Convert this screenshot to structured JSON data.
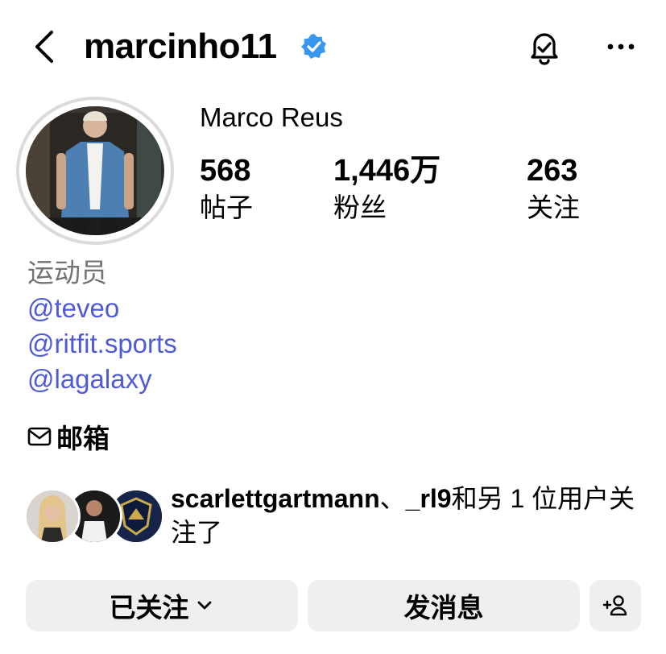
{
  "header": {
    "username": "marcinho11"
  },
  "profile": {
    "display_name": "Marco Reus",
    "stats": [
      {
        "value": "568",
        "label": "帖子"
      },
      {
        "value": "1,446万",
        "label": "粉丝"
      },
      {
        "value": "263",
        "label": "关注"
      }
    ],
    "category": "运动员",
    "links": [
      "@teveo",
      "@ritfit.sports",
      "@lagalaxy"
    ],
    "email_label": "邮箱"
  },
  "followed_by": {
    "user1": "scarlettgartmann",
    "sep": "、",
    "user2": "_rl9",
    "rest": "和另 1 位用户关注了"
  },
  "actions": {
    "following_label": "已关注",
    "message_label": "发消息"
  },
  "colors": {
    "link": "#4f5bd5",
    "verified": "#3797f0",
    "button_bg": "#efefef"
  },
  "icons": [
    "back-icon",
    "verified-badge-icon",
    "notification-bell-icon",
    "more-options-icon",
    "mail-icon",
    "chevron-down-icon",
    "add-person-icon"
  ]
}
